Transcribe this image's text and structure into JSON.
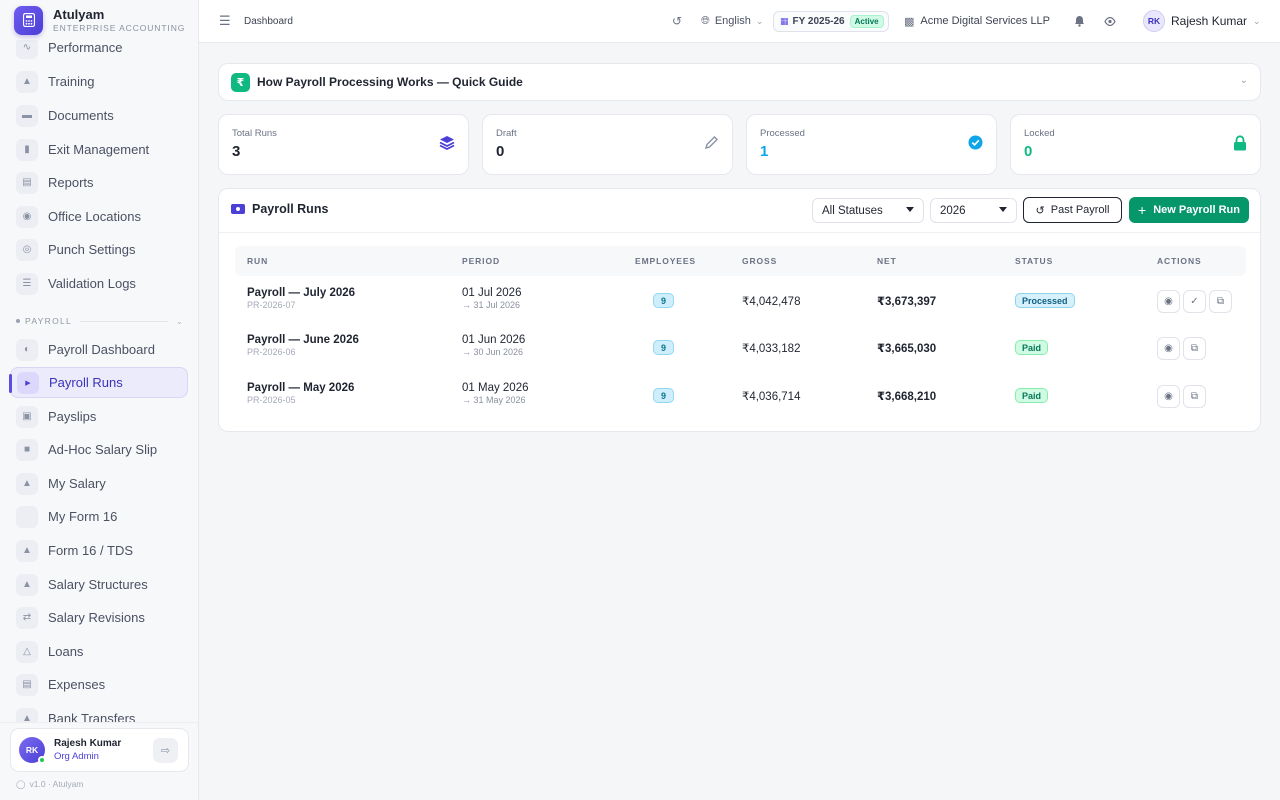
{
  "colors": {
    "accent": "#4b3fd6",
    "success": "#059669",
    "processed": "#0ea5e9",
    "locked": "#10b981"
  },
  "brand": {
    "name": "Atulyam",
    "subtitle": "ENTERPRISE ACCOUNTING",
    "logo_icon": "calculator-icon"
  },
  "sidebar": {
    "items_top": [
      {
        "label": "Performance",
        "icon": "chart-line-icon"
      },
      {
        "label": "Training",
        "icon": "graduation-cap-icon"
      },
      {
        "label": "Documents",
        "icon": "folder-icon"
      },
      {
        "label": "Exit Management",
        "icon": "user-exit-icon"
      },
      {
        "label": "Reports",
        "icon": "bar-chart-icon"
      },
      {
        "label": "Office Locations",
        "icon": "map-pin-icon"
      },
      {
        "label": "Punch Settings",
        "icon": "fingerprint-icon"
      },
      {
        "label": "Validation Logs",
        "icon": "list-check-icon"
      }
    ],
    "section_label": "PAYROLL",
    "items_payroll": [
      {
        "label": "Payroll Dashboard",
        "icon": "gauge-icon",
        "active": false
      },
      {
        "label": "Payroll Runs",
        "icon": "play-circle-icon",
        "active": true
      },
      {
        "label": "Payslips",
        "icon": "file-invoice-icon",
        "active": false
      },
      {
        "label": "Ad-Hoc Salary Slip",
        "icon": "file-plus-icon",
        "active": false
      },
      {
        "label": "My Salary",
        "icon": "wallet-icon",
        "active": false
      },
      {
        "label": "My Form 16",
        "icon": "",
        "active": false
      },
      {
        "label": "Form 16 / TDS",
        "icon": "stamp-icon",
        "active": false
      },
      {
        "label": "Salary Structures",
        "icon": "sitemap-icon",
        "active": false
      },
      {
        "label": "Salary Revisions",
        "icon": "arrows-exchange-icon",
        "active": false
      },
      {
        "label": "Loans",
        "icon": "hand-coin-icon",
        "active": false
      },
      {
        "label": "Expenses",
        "icon": "receipt-icon",
        "active": false
      },
      {
        "label": "Bank Transfers",
        "icon": "bank-icon",
        "active": false
      }
    ],
    "user": {
      "initials": "RK",
      "name": "Rajesh Kumar",
      "role": "Org Admin"
    },
    "version": "v1.0 · Atulyam"
  },
  "topbar": {
    "breadcrumb": "Dashboard",
    "language": "English",
    "fy_label": "FY 2025-26",
    "fy_status": "Active",
    "org_name": "Acme Digital Services LLP",
    "profile_initials": "RK",
    "profile_name": "Rajesh Kumar"
  },
  "guide": {
    "icon": "₹",
    "title": "How Payroll Processing Works — Quick Guide"
  },
  "stats": [
    {
      "label": "Total Runs",
      "value": "3",
      "icon": "layers-icon",
      "color": "#4b3fd6",
      "value_color": "#1f2430"
    },
    {
      "label": "Draft",
      "value": "0",
      "icon": "pencil-icon",
      "color": "#8a92a6",
      "value_color": "#1f2430"
    },
    {
      "label": "Processed",
      "value": "1",
      "icon": "check-circle-icon",
      "color": "#0ea5e9",
      "value_color": "#0ea5e9"
    },
    {
      "label": "Locked",
      "value": "0",
      "icon": "lock-icon",
      "color": "#10b981",
      "value_color": "#10b981"
    }
  ],
  "runs": {
    "title": "Payroll Runs",
    "status_filter": "All Statuses",
    "year_filter": "2026",
    "past_payroll_label": "Past Payroll",
    "new_run_label": "New Payroll Run",
    "columns": [
      "RUN",
      "PERIOD",
      "EMPLOYEES",
      "GROSS",
      "NET",
      "STATUS",
      "ACTIONS"
    ],
    "rows": [
      {
        "name": "Payroll — July 2026",
        "code": "PR-2026-07",
        "period_start": "01 Jul 2026",
        "period_end": "→ 31 Jul 2026",
        "employees": "9",
        "gross": "₹4,042,478",
        "net": "₹3,673,397",
        "status": "Processed",
        "actions": [
          "view-icon",
          "approve-icon",
          "copy-icon"
        ]
      },
      {
        "name": "Payroll — June 2026",
        "code": "PR-2026-06",
        "period_start": "01 Jun 2026",
        "period_end": "→ 30 Jun 2026",
        "employees": "9",
        "gross": "₹4,033,182",
        "net": "₹3,665,030",
        "status": "Paid",
        "actions": [
          "view-icon",
          "copy-icon"
        ]
      },
      {
        "name": "Payroll — May 2026",
        "code": "PR-2026-05",
        "period_start": "01 May 2026",
        "period_end": "→ 31 May 2026",
        "employees": "9",
        "gross": "₹4,036,714",
        "net": "₹3,668,210",
        "status": "Paid",
        "actions": [
          "view-icon",
          "copy-icon"
        ]
      }
    ]
  }
}
